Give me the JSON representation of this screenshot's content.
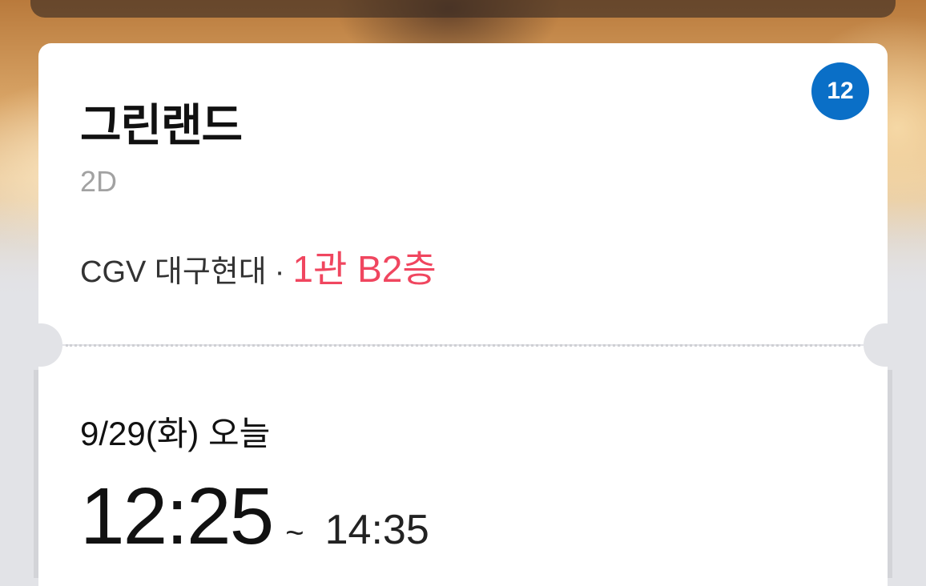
{
  "movie": {
    "title": "그린랜드",
    "format": "2D",
    "rating": "12"
  },
  "location": {
    "theater": "CGV 대구현대",
    "separator": "·",
    "hall": "1관 B2층"
  },
  "schedule": {
    "date": "9/29(화) 오늘",
    "start_time": "12:25",
    "tilde": "~",
    "end_time": "14:35"
  },
  "colors": {
    "rating_badge": "#0a6fc7",
    "hall_accent": "#f0465f"
  }
}
